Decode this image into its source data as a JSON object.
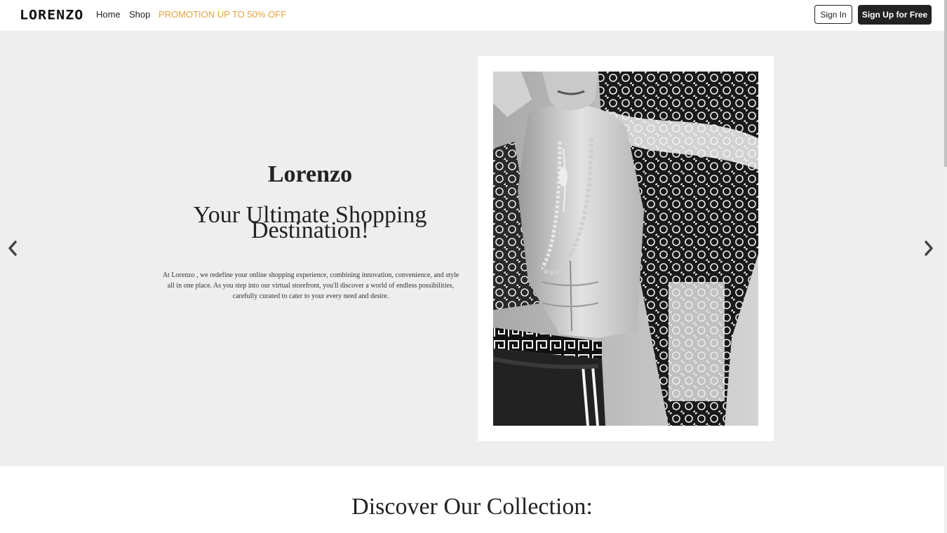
{
  "nav": {
    "logo": "LORENZO",
    "links": [
      {
        "label": "Home"
      },
      {
        "label": "Shop"
      },
      {
        "label": "PROMOTION UP TO 50% OFF"
      }
    ],
    "sign_in": "Sign In",
    "sign_up": "Sign Up for Free"
  },
  "hero": {
    "brand": "Lorenzo",
    "tagline_line1": "Your Ultimate Shopping",
    "tagline_line2": "Destination!",
    "description": "At Lorenzo , we redefine your online shopping experience, combining innovation, convenience, and style all in one place. As you step into our virtual storefront, you'll discover a world of endless possibilities, carefully curated to cater to your every need and desire.",
    "prev_icon": "chevron-left-icon",
    "next_icon": "chevron-right-icon"
  },
  "collection": {
    "title": "Discover Our Collection:"
  },
  "colors": {
    "accent_promo": "#e0a33e",
    "hero_bg": "#eeeeee",
    "dark_button": "#222222"
  }
}
